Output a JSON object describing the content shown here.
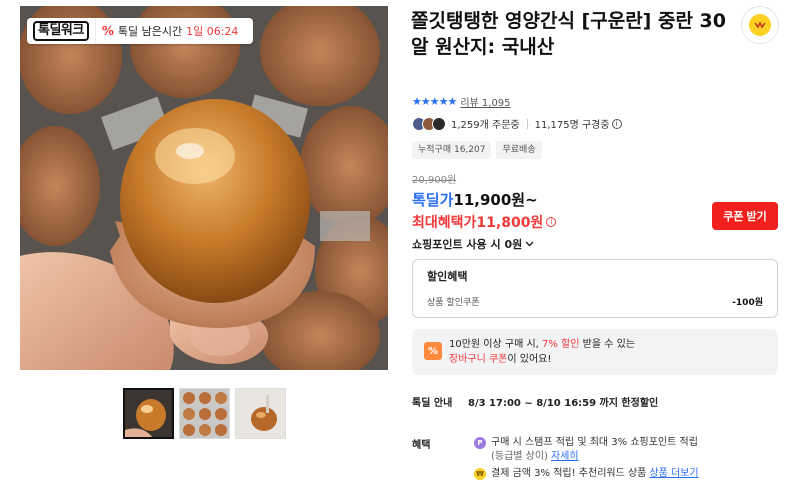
{
  "promo": {
    "logo": "톡딜워크",
    "percent_icon": "%",
    "text": "톡딜 남은시간",
    "time": "1일 06:24"
  },
  "product": {
    "title": "쫄깃탱탱한 영양간식 [구운란] 중란 30알 원산지: 국내산",
    "rating_stars": "★★★★★",
    "review_label": "리뷰",
    "review_count": "1,095",
    "orders": "1,259개 주문중",
    "watchers": "11,175명 구경중",
    "tags": [
      "누적구매 16,207",
      "무료배송"
    ],
    "original_price": "20,900원",
    "deal_label": "톡딜가",
    "deal_price": "11,900원~",
    "max_label": "최대혜택가",
    "max_price": "11,800원",
    "coupon_button": "쿠폰 받기",
    "points_label": "쇼핑포인트 사용 시",
    "points_value": "0원"
  },
  "discount": {
    "title": "할인혜택",
    "row_label": "상품 할인쿠폰",
    "row_amount": "-100원"
  },
  "cart_promo": {
    "icon": "%",
    "line1_pre": "10만원 이상 구매 시, ",
    "line1_hl": "7% 할인",
    "line1_post": " 받을 수 있는",
    "line2_hl": "장바구니 쿠폰",
    "line2_post": "이 있어요!"
  },
  "deal_info": {
    "label": "톡딜 안내",
    "value": "8/3 17:00 ~ 8/10 16:59 까지 한정할인"
  },
  "benefits": {
    "label": "혜택",
    "item1_icon": "P",
    "item1": "구매 시 스탬프 적립 및 최대 3% 쇼핑포인트 적립",
    "item1_sub": "(등급별 상이)",
    "item1_link": "자세히",
    "item2_icon": "₩",
    "item2": "결제 금액 3% 적립! 추천리워드 상품",
    "item2_link": "상품 더보기"
  },
  "icons": {
    "share": "share-icon",
    "info": "info-icon",
    "chevron": "chevron-down-icon"
  },
  "colors": {
    "accent_blue": "#2b6ef5",
    "accent_red": "#f23a3a",
    "coupon_red": "#f0201c",
    "kakao_yellow": "#ffcf24"
  }
}
